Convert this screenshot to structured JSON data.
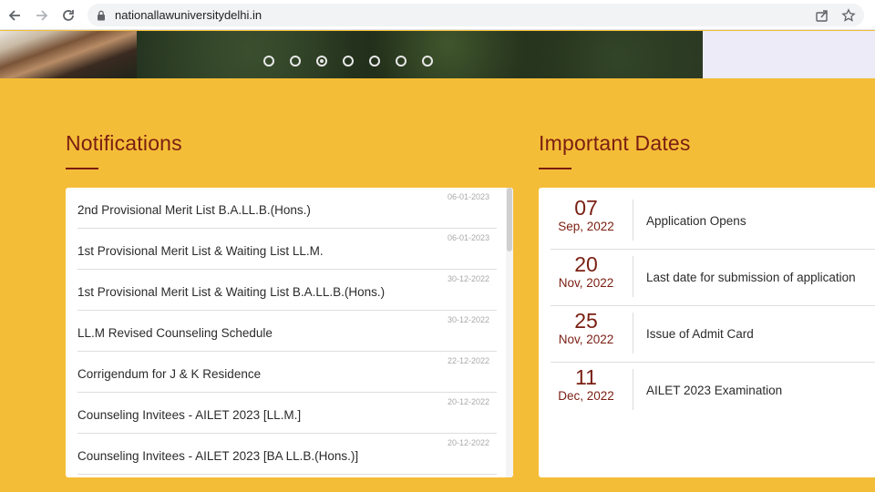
{
  "browser": {
    "url": "nationallawuniversitydelhi.in",
    "icons": {
      "back": "back-arrow-icon",
      "forward": "forward-arrow-icon",
      "reload": "reload-icon",
      "lock": "lock-icon",
      "share": "share-icon",
      "bookmark": "star-icon"
    }
  },
  "hero": {
    "slide_count": 7,
    "active_slide": 3
  },
  "notifications": {
    "title": "Notifications",
    "items": [
      {
        "date": "06-01-2023",
        "text": "2nd Provisional Merit List B.A.LL.B.(Hons.)"
      },
      {
        "date": "06-01-2023",
        "text": "1st Provisional Merit List & Waiting List LL.M."
      },
      {
        "date": "30-12-2022",
        "text": "1st Provisional Merit List & Waiting List B.A.LL.B.(Hons.)"
      },
      {
        "date": "30-12-2022",
        "text": "LL.M Revised Counseling Schedule"
      },
      {
        "date": "22-12-2022",
        "text": "Corrigendum for J & K Residence"
      },
      {
        "date": "20-12-2022",
        "text": "Counseling Invitees - AILET 2023 [LL.M.]"
      },
      {
        "date": "20-12-2022",
        "text": "Counseling Invitees - AILET 2023 [BA LL.B.(Hons.)]"
      }
    ]
  },
  "important_dates": {
    "title": "Important Dates",
    "items": [
      {
        "day": "07",
        "month": "Sep, 2022",
        "event": "Application Opens"
      },
      {
        "day": "20",
        "month": "Nov, 2022",
        "event": "Last date for submission of application"
      },
      {
        "day": "25",
        "month": "Nov, 2022",
        "event": "Issue of Admit Card"
      },
      {
        "day": "11",
        "month": "Dec, 2022",
        "event": "AILET 2023 Examination"
      }
    ]
  },
  "colors": {
    "accent": "#7a1e12",
    "background": "#f4bd37"
  }
}
